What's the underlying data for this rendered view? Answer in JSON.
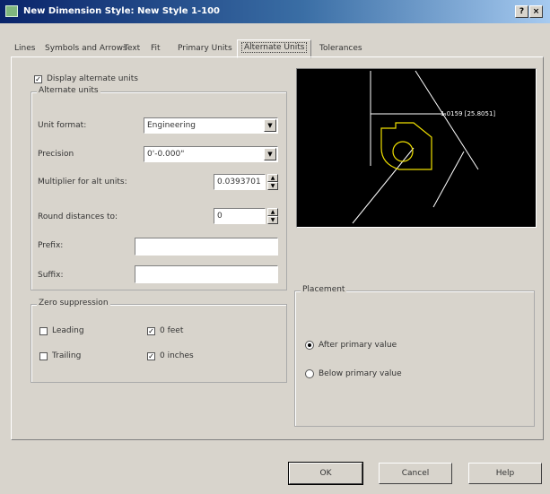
{
  "window": {
    "title": "New Dimension Style: New Style 1-100",
    "help_glyph": "?",
    "close_glyph": "×"
  },
  "tabs": [
    "Lines",
    "Symbols and Arrows",
    "Text",
    "Fit",
    "Primary Units",
    "Alternate Units",
    "Tolerances"
  ],
  "active_tab": "Alternate Units",
  "display_alternate": {
    "label": "Display alternate units",
    "checked": true
  },
  "alternate_units": {
    "title": "Alternate units",
    "unit_format_label": "Unit format:",
    "unit_format_value": "Engineering",
    "precision_label": "Precision",
    "precision_value": "0'-0.000\"",
    "multiplier_label": "Multiplier for alt units:",
    "multiplier_value": "0.0393701",
    "round_label": "Round distances to:",
    "round_value": "0",
    "prefix_label": "Prefix:",
    "prefix_value": "",
    "suffix_label": "Suffix:",
    "suffix_value": ""
  },
  "zero_suppression": {
    "title": "Zero suppression",
    "leading": {
      "label": "Leading",
      "checked": false
    },
    "trailing": {
      "label": "Trailing",
      "checked": false
    },
    "feet": {
      "label": "0 feet",
      "checked": true
    },
    "inches": {
      "label": "0 inches",
      "checked": true
    }
  },
  "placement": {
    "title": "Placement",
    "after_label": "After primary value",
    "below_label": "Below primary value",
    "selected": "after"
  },
  "preview": {
    "dim_text": "1.0159 [25.8051]"
  },
  "buttons": {
    "ok": "OK",
    "cancel": "Cancel",
    "help": "Help"
  },
  "check_glyph": "✓",
  "dropdown_glyph": "▼",
  "spin_up_glyph": "▲",
  "spin_down_glyph": "▼"
}
